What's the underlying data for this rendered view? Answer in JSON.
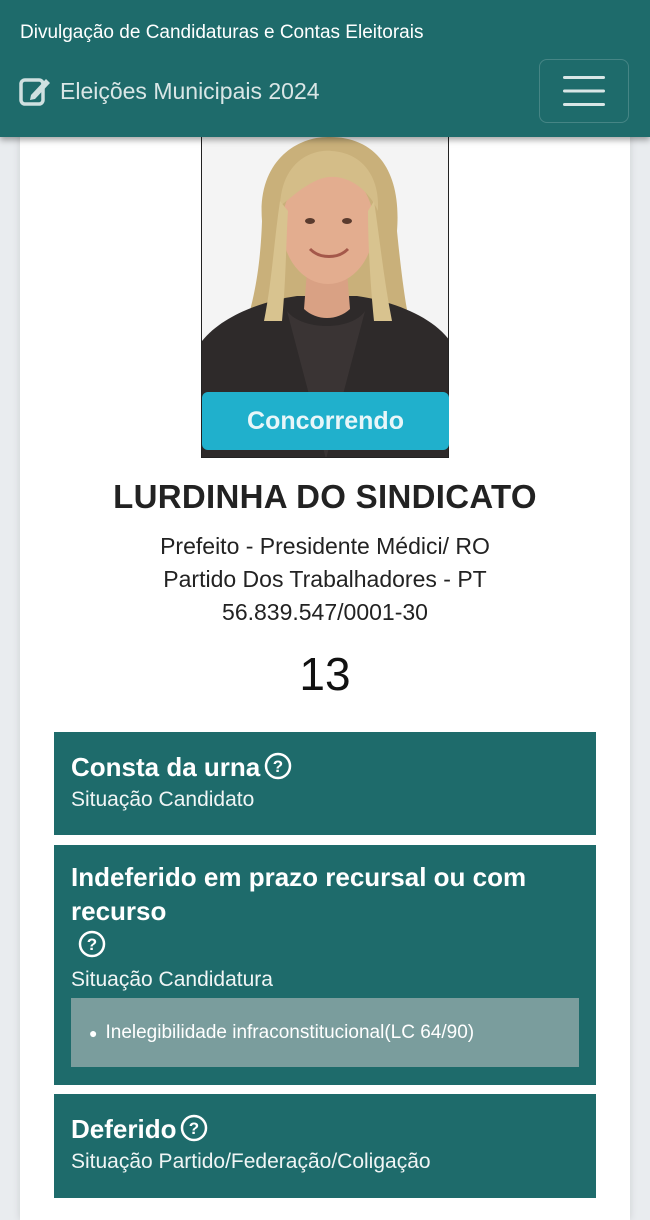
{
  "header": {
    "site_title": "Divulgação de Candidaturas e Contas Eleitorais",
    "brand": "Eleições Municipais 2024",
    "brand_icon": "edit-icon",
    "menu_icon": "hamburger-menu-icon",
    "colors": {
      "bar": "#1e6b6b",
      "badge": "#20b0cc"
    }
  },
  "candidate": {
    "status": "Concorrendo",
    "name": "LURDINHA DO SINDICATO",
    "office_location": "Prefeito - Presidente Médici/ RO",
    "party": "Partido Dos Trabalhadores - PT",
    "cnpj": "56.839.547/0001-30",
    "number": "13"
  },
  "situations": [
    {
      "title": "Consta da urna",
      "subtitle": "Situação Candidato"
    },
    {
      "title": "Indeferido em prazo recursal ou com recurso",
      "subtitle": "Situação Candidatura",
      "reasons": [
        "Inelegibilidade infraconstitucional(LC 64/90)"
      ]
    },
    {
      "title": "Deferido",
      "subtitle": "Situação Partido/Federação/Coligação"
    }
  ]
}
